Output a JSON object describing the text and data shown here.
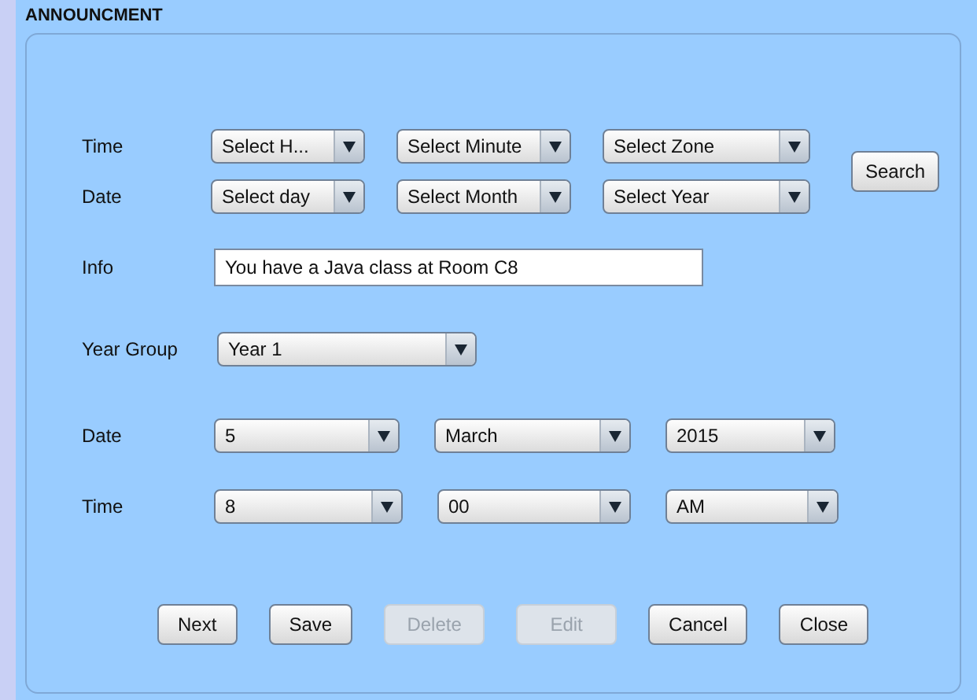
{
  "title": "ANNOUNCMENT",
  "filters": [
    {
      "label": "Time",
      "combos": [
        "Select H...",
        "Select Minute",
        "Select Zone"
      ]
    },
    {
      "label": "Date",
      "combos": [
        "Select day",
        "Select Month",
        "Select Year"
      ]
    }
  ],
  "search_button": "Search",
  "info": {
    "label": "Info",
    "value": "You have a Java class at Room C8"
  },
  "year_group": {
    "label": "Year Group",
    "value": "Year 1"
  },
  "date": {
    "label": "Date",
    "combos": [
      "5",
      "March",
      "2015"
    ]
  },
  "time": {
    "label": "Time",
    "combos": [
      "8",
      "00",
      "AM"
    ]
  },
  "buttons": [
    {
      "label": "Next",
      "disabled": false
    },
    {
      "label": "Save",
      "disabled": false
    },
    {
      "label": "Delete",
      "disabled": true
    },
    {
      "label": "Edit",
      "disabled": true
    },
    {
      "label": "Cancel",
      "disabled": false
    },
    {
      "label": "Close",
      "disabled": false
    }
  ]
}
